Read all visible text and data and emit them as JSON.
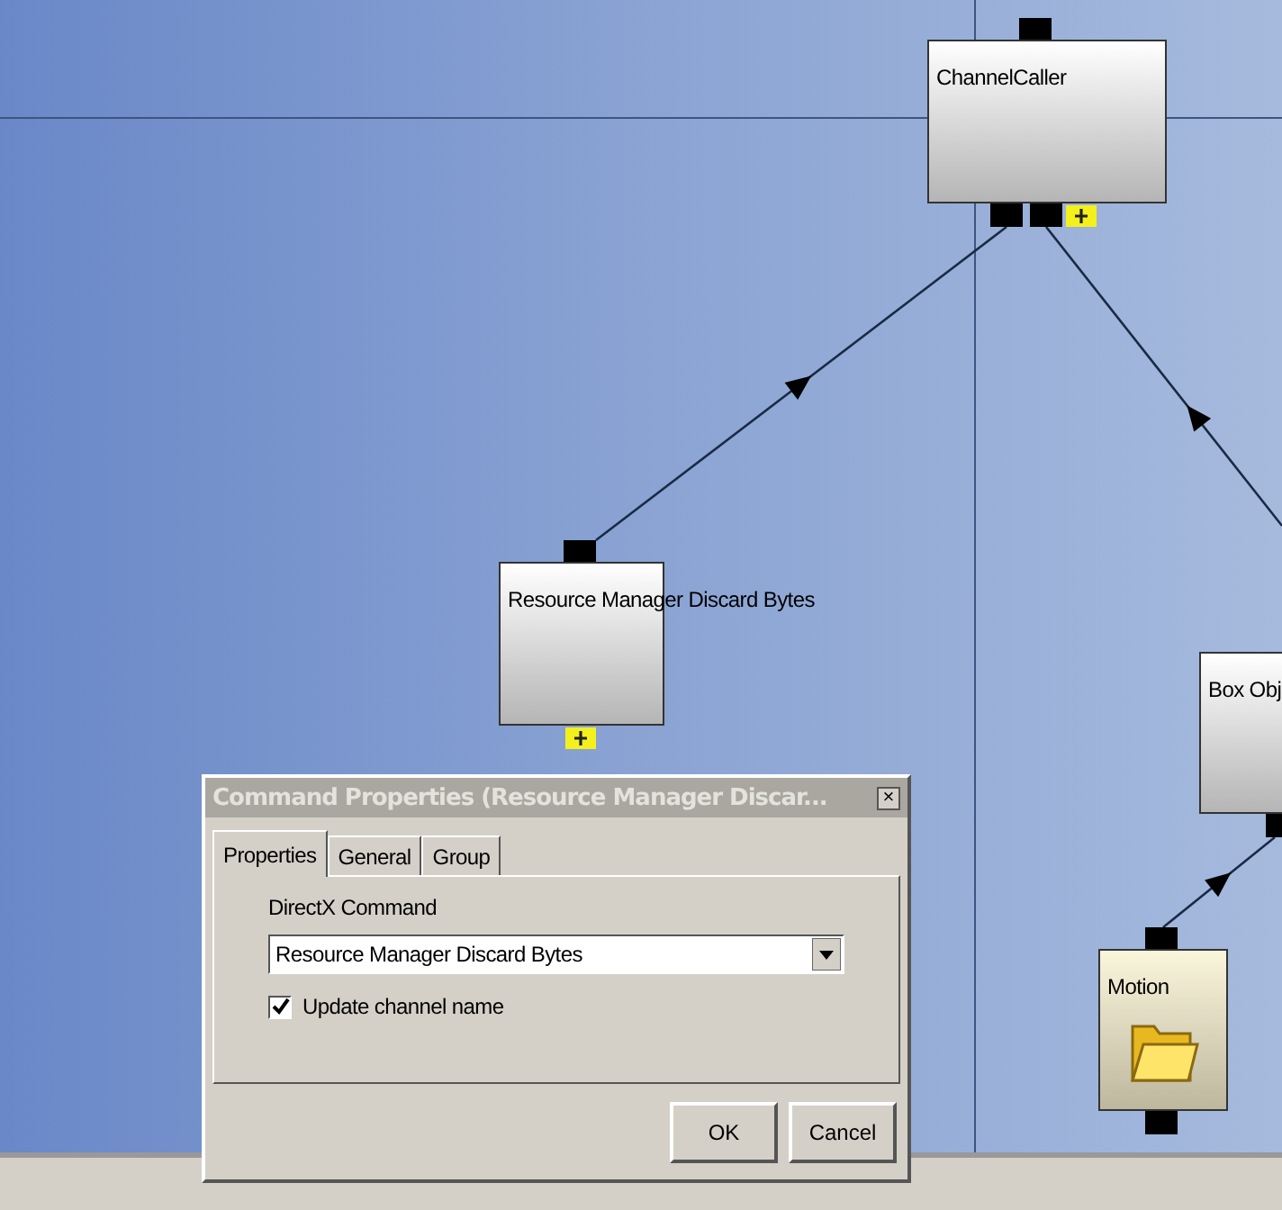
{
  "diagram": {
    "nodes": [
      {
        "label": "ChannelCaller",
        "kind": "command",
        "add_port": true
      },
      {
        "label": "Resource Manager Discard Bytes",
        "kind": "command",
        "add_port": true
      },
      {
        "label": "Box Obj",
        "kind": "command",
        "add_port": false
      },
      {
        "label": "Motion",
        "kind": "folder",
        "add_port": false
      }
    ]
  },
  "dialog": {
    "title": "Command Properties (Resource Manager Discar...",
    "close": "×",
    "tabs": [
      {
        "label": "Properties",
        "selected": true
      },
      {
        "label": "General",
        "selected": false
      },
      {
        "label": "Group",
        "selected": false
      }
    ],
    "field_label": "DirectX Command",
    "select_value": "Resource Manager Discard Bytes",
    "checkbox": {
      "label": "Update channel name",
      "checked": true
    },
    "buttons": [
      "OK",
      "Cancel"
    ]
  }
}
